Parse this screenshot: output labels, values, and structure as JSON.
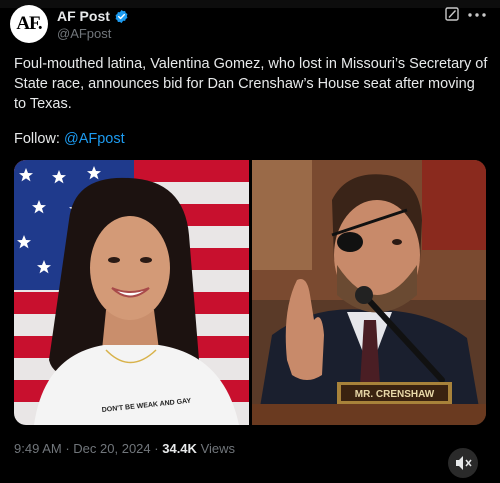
{
  "account": {
    "avatar_text": "AF.",
    "name": "AF Post",
    "handle": "@AFpost"
  },
  "post": {
    "text": "Foul-mouthed latina, Valentina Gomez, who lost in Missouri’s Secretary of State race, announces bid for Dan Crenshaw’s House seat after moving to Texas.",
    "follow_label": "Follow:",
    "follow_link": "@AFpost"
  },
  "images": {
    "left": {
      "shirt_text": "DON'T BE WEAK AND GAY"
    },
    "right": {
      "nameplate": "MR. CRENSHAW"
    }
  },
  "meta": {
    "time": "9:49 AM",
    "separator": "·",
    "date": "Dec 20, 2024",
    "views_count": "34.4K",
    "views_label": "Views"
  },
  "icons": {
    "verified": "verified-badge-icon",
    "grok": "grok-icon",
    "more": "more-options-icon",
    "mute": "mute-icon"
  },
  "colors": {
    "accent": "#1d9bf0",
    "background": "#000000",
    "text": "#e7e9ea",
    "muted": "#71767b"
  }
}
